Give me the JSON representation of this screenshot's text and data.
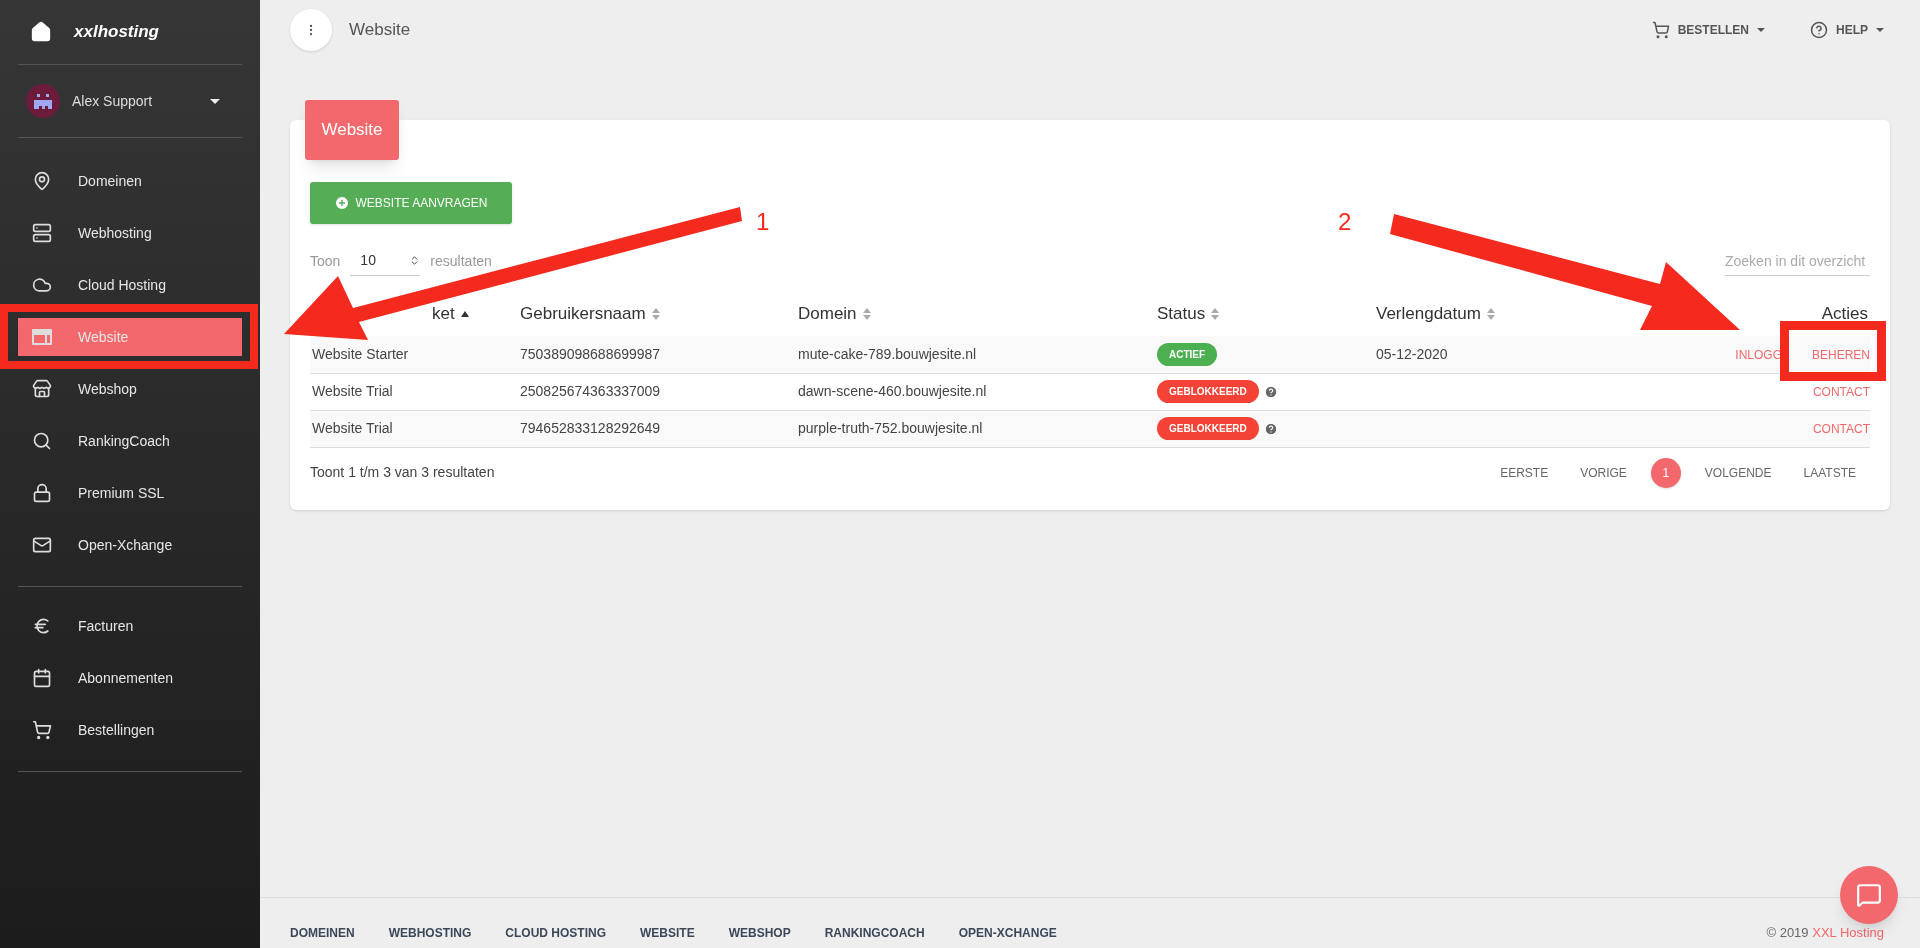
{
  "brand": "xxlhosting",
  "user": {
    "name": "Alex Support"
  },
  "nav_groups": [
    {
      "items": [
        {
          "label": "Domeinen",
          "selected": false
        },
        {
          "label": "Webhosting",
          "selected": false
        },
        {
          "label": "Cloud Hosting",
          "selected": false
        },
        {
          "label": "Website",
          "selected": true
        },
        {
          "label": "Webshop",
          "selected": false
        },
        {
          "label": "RankingCoach",
          "selected": false
        },
        {
          "label": "Premium SSL",
          "selected": false
        },
        {
          "label": "Open-Xchange",
          "selected": false
        }
      ]
    },
    {
      "items": [
        {
          "label": "Facturen",
          "selected": false
        },
        {
          "label": "Abonnementen",
          "selected": false
        },
        {
          "label": "Bestellingen",
          "selected": false
        }
      ]
    }
  ],
  "topbar": {
    "title": "Website",
    "menus": [
      {
        "label": "BESTELLEN"
      },
      {
        "label": "HELP"
      }
    ]
  },
  "card": {
    "title": "Website",
    "primary_button": "WEBSITE AANVRAGEN",
    "show": {
      "prefix": "Toon",
      "value": "10",
      "suffix": "resultaten"
    },
    "search": {
      "placeholder": "Zoeken in dit overzicht"
    },
    "columns": [
      {
        "label": "ket",
        "sorted": true
      },
      {
        "label": "Gebruikersnaam",
        "sorted": false
      },
      {
        "label": "Domein",
        "sorted": false
      },
      {
        "label": "Status",
        "sorted": false
      },
      {
        "label": "Verlengdatum",
        "sorted": false
      },
      {
        "label": "Acties"
      }
    ],
    "rows": [
      {
        "package": "Website Starter",
        "username": "750389098688699987",
        "domain": "mute-cake-789.bouwjesite.nl",
        "status": {
          "label": "ACTIEF",
          "kind": "active",
          "info": false
        },
        "renewal": "05-12-2020",
        "actions": [
          "INLOGG",
          "BEHEREN"
        ]
      },
      {
        "package": "Website Trial",
        "username": "250825674363337009",
        "domain": "dawn-scene-460.bouwjesite.nl",
        "status": {
          "label": "GEBLOKKEERD",
          "kind": "blocked",
          "info": true
        },
        "actions": [
          "CONTACT"
        ]
      },
      {
        "package": "Website Trial",
        "username": "794652833128292649",
        "domain": "purple-truth-752.bouwjesite.nl",
        "status": {
          "label": "GEBLOKKEERD",
          "kind": "blocked",
          "info": true
        },
        "actions": [
          "CONTACT"
        ]
      }
    ],
    "summary": "Toont 1 t/m 3 van 3 resultaten",
    "pagination": [
      {
        "label": "EERSTE",
        "selected": false
      },
      {
        "label": "VORIGE",
        "selected": false
      },
      {
        "label": "1",
        "selected": true
      },
      {
        "label": "VOLGENDE",
        "selected": false
      },
      {
        "label": "LAATSTE",
        "selected": false
      }
    ]
  },
  "footer": {
    "links": [
      "DOMEINEN",
      "WEBHOSTING",
      "CLOUD HOSTING",
      "WEBSITE",
      "WEBSHOP",
      "RANKINGCOACH",
      "OPEN-XCHANGE"
    ],
    "copyright": "© 2019",
    "company": "XXL Hosting"
  },
  "annotations": [
    {
      "label": "1"
    },
    {
      "label": "2"
    }
  ]
}
